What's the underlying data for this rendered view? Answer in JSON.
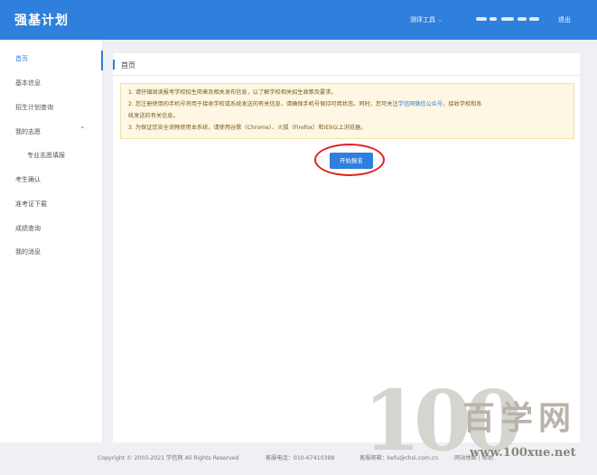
{
  "header": {
    "brand": "强基计划",
    "tools_label": "测评工具",
    "logout_label": "退出"
  },
  "sidebar": {
    "items": [
      {
        "label": "首页"
      },
      {
        "label": "基本信息"
      },
      {
        "label": "招生计划查询"
      },
      {
        "label": "我的志愿"
      },
      {
        "label": "专业志愿填报"
      },
      {
        "label": "考生确认"
      },
      {
        "label": "准考证下载"
      },
      {
        "label": "成绩查询"
      },
      {
        "label": "我的消息"
      }
    ]
  },
  "main": {
    "title": "首页",
    "notice": {
      "line1": "1. 请仔细阅读报考学校招生简章及相关发布信息，以了解学校相关招生政策及要求。",
      "line2_a": "2. 您注册使用的手机号将用于接收学校或系统发送的有关信息，请确保手机号保持可用状态。同时，您可关注",
      "line2_link": "学信网微信公众号",
      "line2_b": "，接收学校和系",
      "line3": "统发送的有关信息。",
      "line4": "3. 为保证您安全流畅使用本系统，请使用谷歌（Chrome）、火狐（Firefox）和IE9以上浏览器。"
    },
    "start_button": "开始报名"
  },
  "footer": {
    "copyright": "Copyright © 2003-2021 学信网 All Rights Reserved",
    "phone": "客服电话：010-67410388",
    "email": "客服邮箱：kefu@chsi.com.cn",
    "extra": "网站地图 | 帮助"
  },
  "watermark": {
    "number": "100",
    "chinese": "百学网",
    "url": "www.100xue.net"
  },
  "colors": {
    "primary": "#2f7fdc",
    "notice_bg": "#fdf7e3",
    "highlight_ring": "#e02020"
  }
}
